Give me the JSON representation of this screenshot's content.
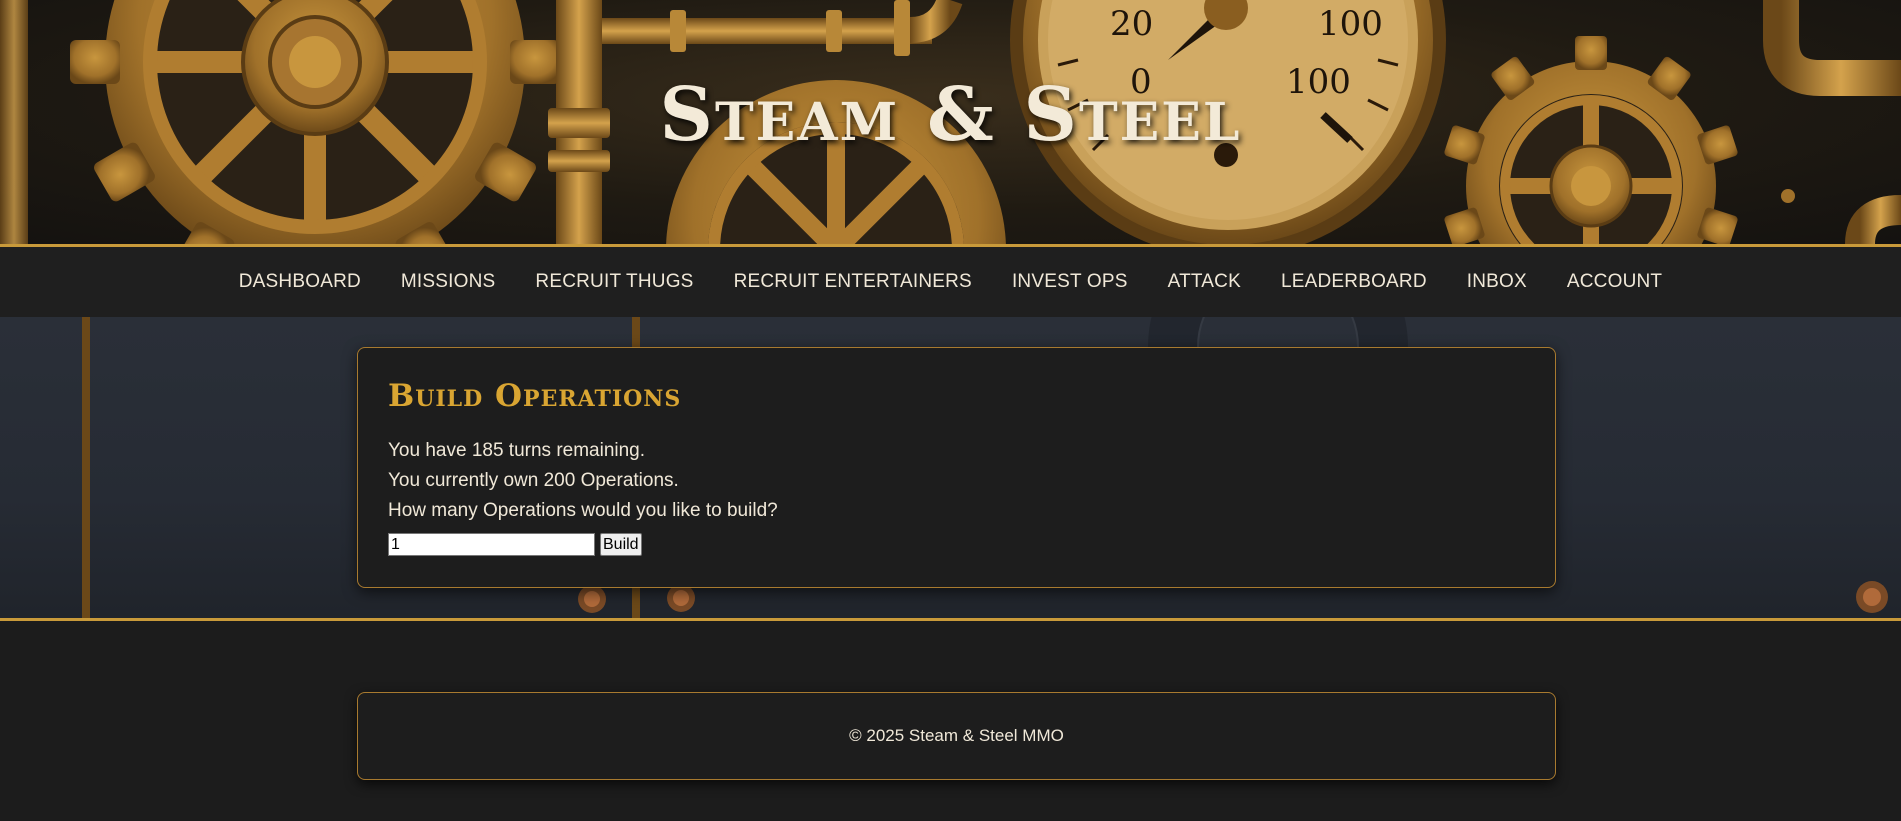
{
  "site": {
    "title": "Steam & Steel"
  },
  "nav": {
    "items": [
      {
        "label": "DASHBOARD"
      },
      {
        "label": "MISSIONS"
      },
      {
        "label": "RECRUIT THUGS"
      },
      {
        "label": "RECRUIT ENTERTAINERS"
      },
      {
        "label": "INVEST OPS"
      },
      {
        "label": "ATTACK"
      },
      {
        "label": "LEADERBOARD"
      },
      {
        "label": "INBOX"
      },
      {
        "label": "ACCOUNT"
      }
    ]
  },
  "panel": {
    "heading": "Build Operations",
    "turns_line": "You have 185 turns remaining.",
    "owned_line": "You currently own 200 Operations.",
    "question": "How many Operations would you like to build?",
    "quantity_value": "1",
    "build_label": "Build"
  },
  "gauge": {
    "labels": [
      "20",
      "100",
      "0",
      "100"
    ]
  },
  "footer": {
    "copyright": "© 2025 Steam & Steel MMO"
  },
  "colors": {
    "accent_gold": "#d9a532",
    "border_brass": "#a87a2f",
    "background": "#1c1c1c",
    "nav_background": "#1f1f1f"
  }
}
